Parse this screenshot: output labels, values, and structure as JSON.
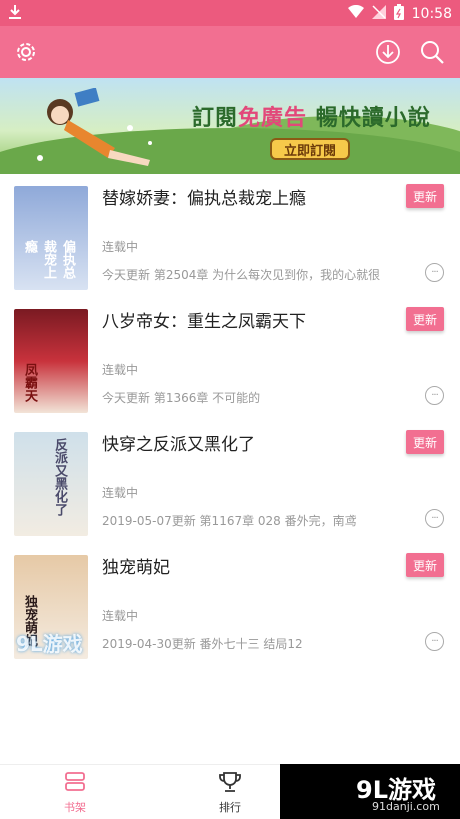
{
  "status_bar": {
    "time": "10:58"
  },
  "banner": {
    "text_prefix": "訂閱",
    "text_highlight": "免廣告",
    "text_suffix": "暢快讀小說",
    "cta_label": "立即訂閱"
  },
  "books": [
    {
      "title": "替嫁娇妻：偏执总裁宠上瘾",
      "status": "连载中",
      "update": "今天更新 第2504章 为什么每次见到你，我的心就很",
      "update_label": "更新",
      "cover_text": "偏执总裁宠上瘾",
      "cover_color": "#b9cbe6"
    },
    {
      "title": "八岁帝女：重生之凤霸天下",
      "status": "连载中",
      "update": "今天更新 第1366章 不可能的",
      "update_label": "更新",
      "cover_text": "凤霸天",
      "cover_color": "#c8323c"
    },
    {
      "title": "快穿之反派又黑化了",
      "status": "连载中",
      "update": "2019-05-07更新 第1167章 028 番外完，南鸢",
      "update_label": "更新",
      "cover_text": "反派又黑化了",
      "cover_color": "#dbe3ea"
    },
    {
      "title": "独宠萌妃",
      "status": "连载中",
      "update": "2019-04-30更新 番外七十三 结局12",
      "update_label": "更新",
      "cover_text": "独宠萌妃",
      "cover_color": "#e8d2b8"
    }
  ],
  "tabs": [
    {
      "label": "书架",
      "active": true
    },
    {
      "label": "排行",
      "active": false
    }
  ],
  "watermark": {
    "brand": "9L游戏",
    "url": "91danji.com"
  },
  "cover_watermark": "9L游戏",
  "colors": {
    "accent": "#f26f91",
    "status_bar": "#ec5a7e"
  }
}
